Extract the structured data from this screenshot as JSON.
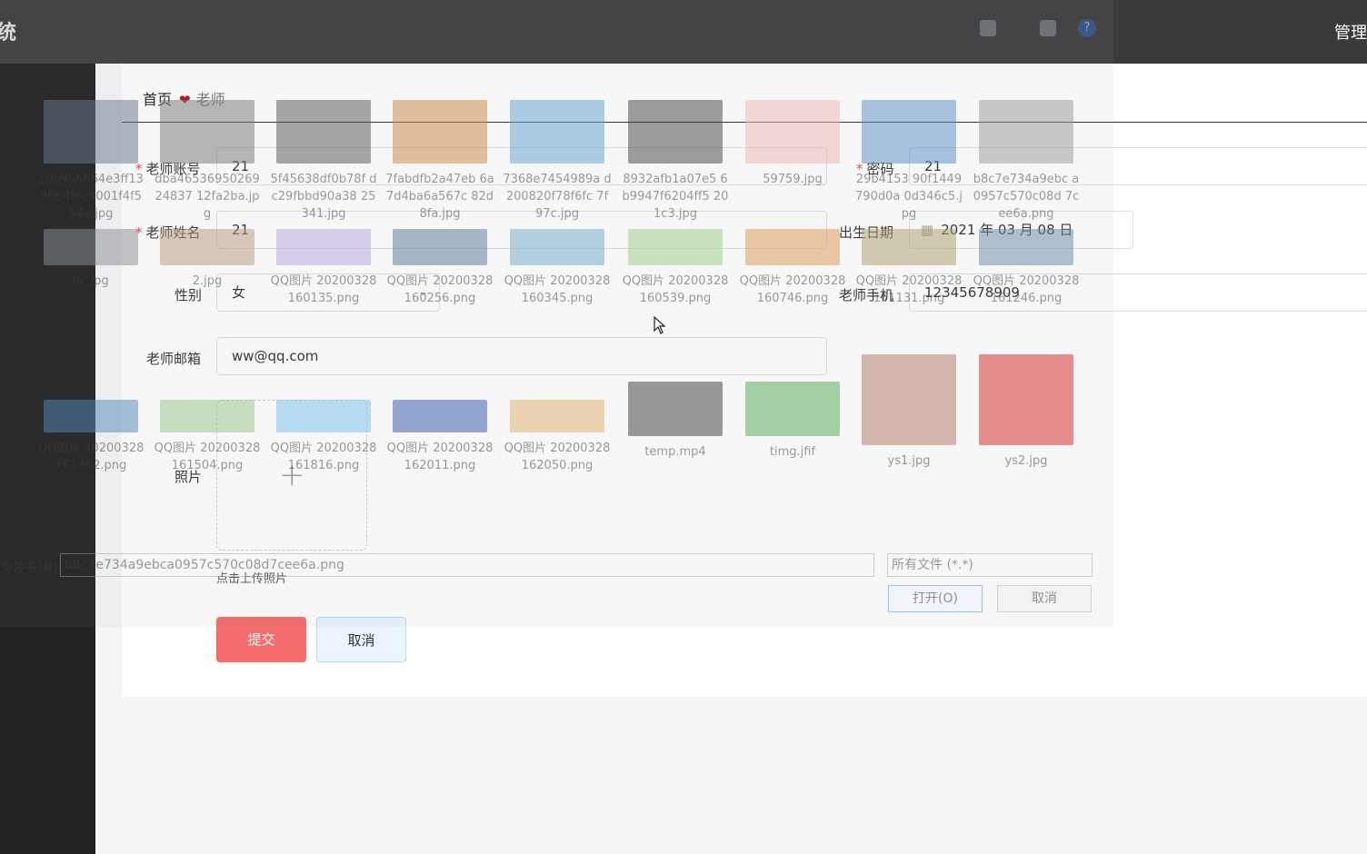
{
  "app": {
    "title_fragment": "统",
    "admin_label": "管理"
  },
  "breadcrumb": {
    "home": "首页",
    "current": "老师"
  },
  "form": {
    "account": {
      "label": "老师账号",
      "value": "21"
    },
    "password": {
      "label": "密码",
      "value": "21"
    },
    "name": {
      "label": "老师姓名",
      "value": "21"
    },
    "birth": {
      "label": "出生日期",
      "value": "2021 年 03 月 08 日"
    },
    "gender": {
      "label": "性别",
      "value": "女"
    },
    "phone": {
      "label": "老师手机",
      "value": "12345678909"
    },
    "email": {
      "label": "老师邮箱",
      "value": "ww@qq.com"
    },
    "photo": {
      "label": "照片",
      "hint": "点击上传照片"
    },
    "submit_label": "提交",
    "cancel_label": "取消"
  },
  "file_dialog": {
    "files_row1": [
      "1de9b6664e3ff1330b4f6c4001f4f554a.jpg",
      "dba4653695026924837 12fa2ba.jpg",
      "5f45638df0b78f dc29fbbd90a38 25341.jpg",
      "7fabdfb2a47eb 6a7d4ba6a567c 82d8fa.jpg",
      "7368e7454989a d200820f78f6fc 7f97c.jpg",
      "8932afb1a07e5 6b9947f6204ff5 201c3.jpg",
      "59759.jpg",
      "29b4153 90f1449790d0a 0d346c5.jpg",
      "b8c7e734a9ebc a0957c570c08d 7cee6a.png"
    ],
    "files_row2": [
      "hc.jpg",
      "2.jpg",
      "QQ图片 20200328160135.png",
      "QQ图片 20200328160256.png",
      "QQ图片 20200328160345.png",
      "QQ图片 20200328160539.png",
      "QQ图片 20200328160746.png",
      "QQ图片 20200328161131.png",
      "QQ图片 20200328161246.png"
    ],
    "files_row3": [
      "QQ图片 20200328161352.png",
      "QQ图片 20200328161504.png",
      "QQ图片 20200328161816.png",
      "QQ图片 20200328162011.png",
      "QQ图片 20200328162050.png",
      "temp.mp4",
      "timg.jfif",
      "ys1.jpg",
      "ys2.jpg"
    ],
    "filename_label": "文件名(N):",
    "filename_value": "b8c7e734a9ebca0957c570c08d7cee6a.png",
    "filetype_value": "所有文件 (*.*)",
    "open_label": "打开(O)",
    "cancel_label": "取消"
  },
  "colors": {
    "primary_danger": "#f56c6c",
    "topbar": "#3a3a3a",
    "sidebar": "#222222"
  }
}
